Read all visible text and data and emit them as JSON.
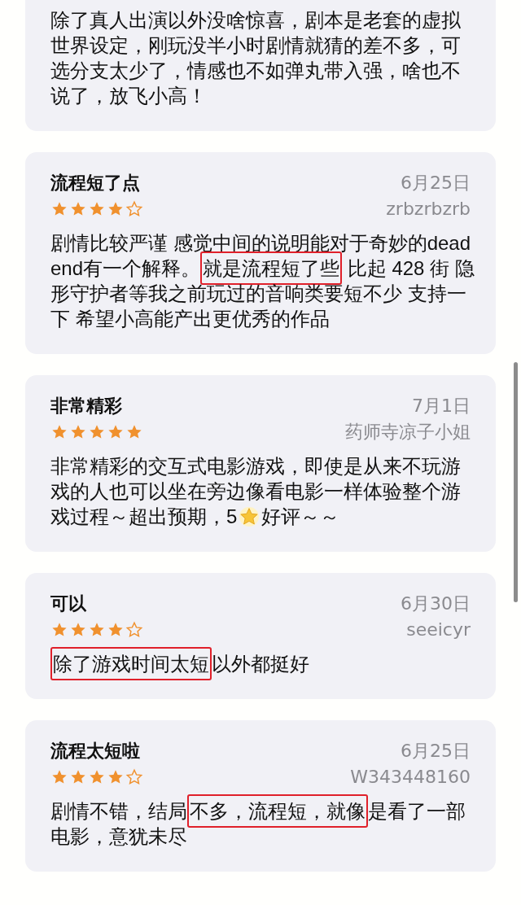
{
  "reviews": [
    {
      "body": [
        {
          "text": "除了真人出演以外没啥惊喜，剧本是老套的虚拟世界设定，刚玩没半小时剧情就猜的差不多，可选分支太少了，情感也不如弹丸带入强，啥也不说了，放飞小高！",
          "highlighted": false
        }
      ]
    },
    {
      "title": "流程短了点",
      "date": "6月25日",
      "stars": 4,
      "author": "zrbzrbzrb",
      "body": [
        {
          "text": "剧情比较严谨 感觉中间的说明能对于奇妙的dead end有一个解释。",
          "highlighted": false
        },
        {
          "text": "就是流程短了些",
          "highlighted": true
        },
        {
          "text": " 比起 428 街 隐形守护者等我之前玩过的音响类要短不少 支持一下 希望小高能产出更优秀的作品",
          "highlighted": false
        }
      ]
    },
    {
      "title": "非常精彩",
      "date": "7月1日",
      "stars": 5,
      "author": "药师寺凉子小姐",
      "body": [
        {
          "text": "非常精彩的交互式电影游戏，即使是从来不玩游戏的人也可以坐在旁边像看电影一样体验整个游戏过程～超出预期，5",
          "highlighted": false
        },
        {
          "kind": "star-icon"
        },
        {
          "text": "好评～～",
          "highlighted": false
        }
      ]
    },
    {
      "title": "可以",
      "date": "6月30日",
      "stars": 4,
      "author": "seeicyr",
      "body": [
        {
          "text": "除了游戏时间太短",
          "highlighted": true
        },
        {
          "text": "以外都挺好",
          "highlighted": false
        }
      ]
    },
    {
      "title": "流程太短啦",
      "date": "6月25日",
      "stars": 4,
      "author": "W343448160",
      "body": [
        {
          "text": "剧情不错，结局",
          "highlighted": false
        },
        {
          "text": "不多，流程短，就像",
          "highlighted": true
        },
        {
          "text": "是看了一部电影，意犹未尽",
          "highlighted": false
        }
      ]
    }
  ]
}
